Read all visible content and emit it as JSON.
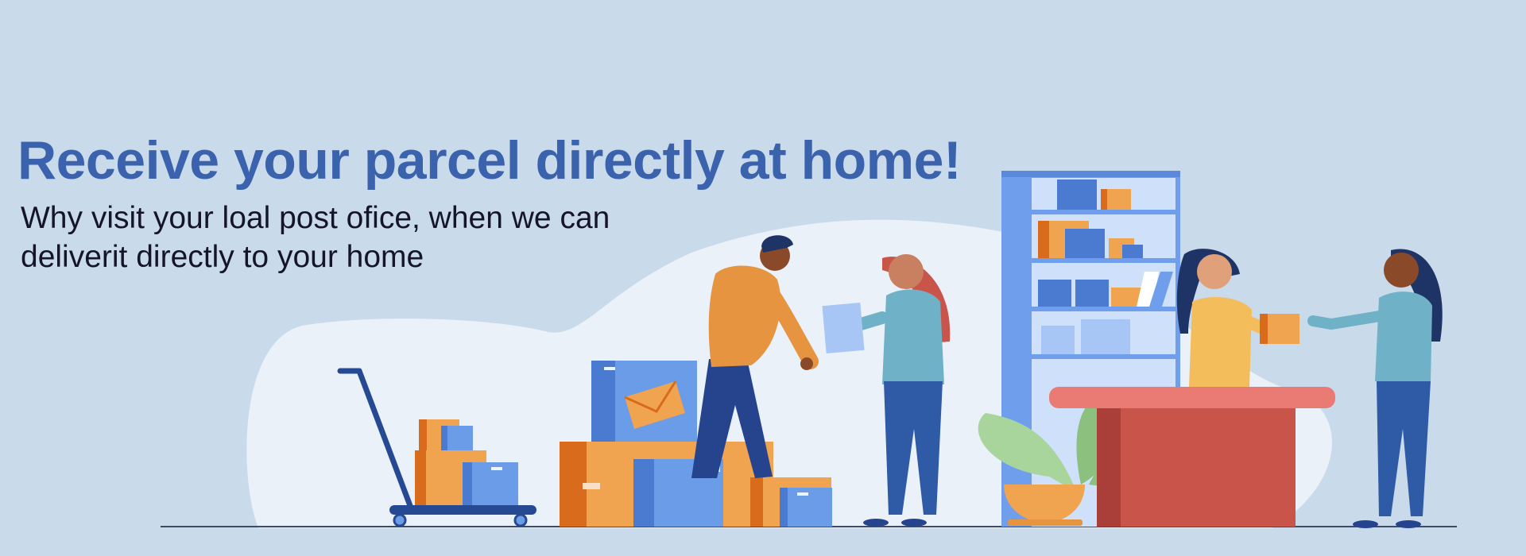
{
  "banner": {
    "headline": "Receive your parcel directly at home!",
    "subline_1": "Why visit your loal post ofice, when we can",
    "subline_2": "deliverit directly to your home"
  },
  "colors": {
    "background": "#c9daea",
    "blob": "#eaf1f8",
    "headline": "#3a62ad",
    "body_text": "#15152a",
    "box_orange": "#f0a450",
    "box_blue": "#6b9ce8",
    "counter_red": "#c9554a",
    "shelf_blue": "#6f9fec"
  }
}
